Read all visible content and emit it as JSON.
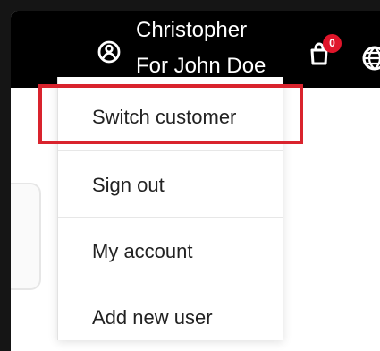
{
  "header": {
    "user_name": "Christopher",
    "user_subtitle": "For John Doe",
    "cart_count": "0"
  },
  "dropdown": {
    "items": [
      {
        "label": "Switch customer"
      },
      {
        "label": "Sign out"
      },
      {
        "label": "My account"
      },
      {
        "label": "Add new user"
      }
    ]
  },
  "annotation": {
    "highlight_color": "#d9232d"
  },
  "colors": {
    "topbar": "#000000",
    "badge": "#e0152a",
    "background": "#ffffff"
  },
  "icons": {
    "user": "user-icon",
    "cart": "cart-icon",
    "globe": "globe-icon"
  }
}
